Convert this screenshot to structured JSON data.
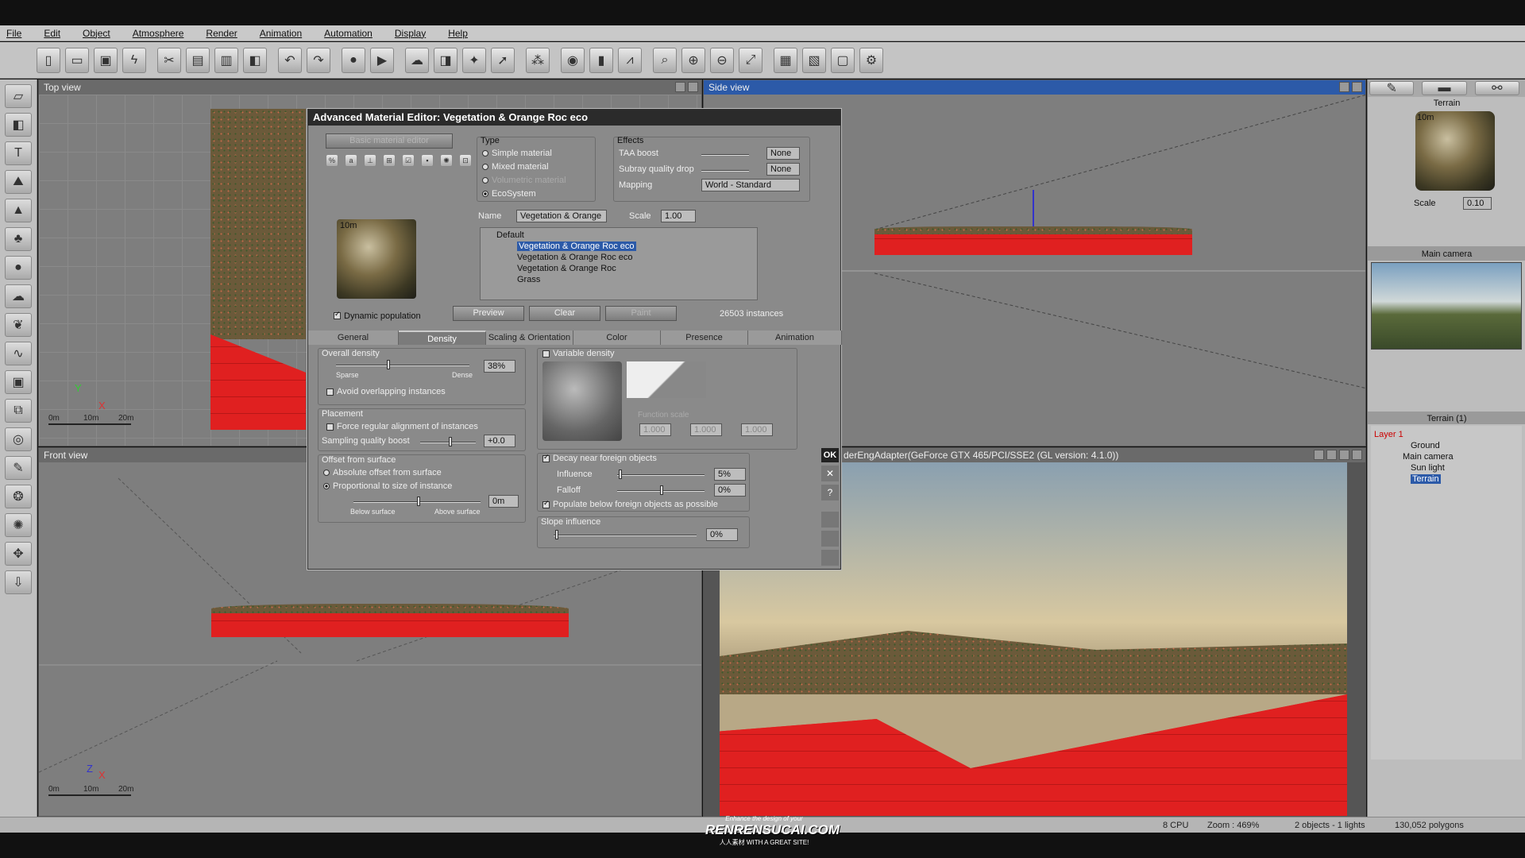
{
  "menu": [
    "File",
    "Edit",
    "Object",
    "Atmosphere",
    "Render",
    "Animation",
    "Automation",
    "Display",
    "Help"
  ],
  "toolbar_icons": [
    "new-icon",
    "open-icon",
    "save-icon",
    "bolt-icon",
    "cut-icon",
    "copy-icon",
    "paste-icon",
    "box-icon",
    "undo-icon",
    "redo-icon",
    "record-icon",
    "play-icon",
    "cloud-icon",
    "cube-icon",
    "wand-icon",
    "pointer-icon",
    "color-balls-icon",
    "sphere-icon",
    "bars-icon",
    "arrow-icon",
    "zoom-fit-icon",
    "zoom-in-icon",
    "zoom-out-icon",
    "pan-icon",
    "film-icon",
    "clapper-icon",
    "frame-icon",
    "render-icon"
  ],
  "viewports": {
    "top": {
      "title": "Top view",
      "scale": [
        "0m",
        "10m",
        "20m"
      ],
      "axis": [
        "Y",
        "X"
      ]
    },
    "front": {
      "title": "Front view",
      "scale": [
        "0m",
        "10m",
        "20m"
      ],
      "axis": [
        "Z",
        "X"
      ]
    },
    "side": {
      "title": "Side view"
    },
    "main": {
      "title": "derEngAdapter(GeForce GTX 465/PCI/SSE2 (GL version: 4.1.0))"
    }
  },
  "dialog": {
    "title": "Advanced Material Editor: Vegetation & Orange Roc eco",
    "basic_button": "Basic material editor",
    "preview_size": "10m",
    "dynamic_population": "Dynamic population",
    "type": {
      "label": "Type",
      "options": [
        "Simple material",
        "Mixed material",
        "Volumetric material",
        "EcoSystem"
      ],
      "selected": "EcoSystem"
    },
    "effects": {
      "label": "Effects",
      "taa_label": "TAA boost",
      "taa_value": "None",
      "subray_label": "Subray quality drop",
      "subray_value": "None",
      "mapping_label": "Mapping",
      "mapping_value": "World - Standard"
    },
    "name_label": "Name",
    "name_value": "Vegetation & Orange",
    "scale_label": "Scale",
    "scale_value": "1.00",
    "tree": [
      "Default",
      "Vegetation & Orange Roc eco",
      "Vegetation & Orange Roc eco",
      "Vegetation & Orange Roc",
      "Grass"
    ],
    "preview_btn": "Preview",
    "clear_btn": "Clear",
    "paint_btn": "Paint",
    "instances": "26503 instances",
    "tabs": [
      "General",
      "Density",
      "Scaling & Orientation",
      "Color",
      "Presence",
      "Animation"
    ],
    "active_tab": "Density",
    "overall_density": {
      "label": "Overall density",
      "sparse": "Sparse",
      "dense": "Dense",
      "value": "38%"
    },
    "avoid_overlap": "Avoid overlapping instances",
    "placement": {
      "label": "Placement",
      "force": "Force regular alignment of instances",
      "boost_label": "Sampling quality boost",
      "boost_value": "+0.0"
    },
    "offset": {
      "label": "Offset from surface",
      "absolute": "Absolute offset from surface",
      "proportional": "Proportional to size of instance",
      "below": "Below surface",
      "above": "Above surface",
      "value": "0m"
    },
    "variable_density": "Variable density",
    "function_scale": "Function scale",
    "fs_x": "1.000",
    "fs_y": "1.000",
    "fs_z": "1.000",
    "decay": "Decay near foreign objects",
    "influence_label": "Influence",
    "influence_value": "5%",
    "falloff_label": "Falloff",
    "falloff_value": "0%",
    "populate_below": "Populate below foreign objects as possible",
    "slope_label": "Slope influence",
    "slope_value": "0%",
    "ok": "OK",
    "close": "✕",
    "help": "?"
  },
  "right_panel": {
    "terrain_label": "Terrain",
    "preview_size": "10m",
    "scale_label": "Scale",
    "scale_value": "0.10",
    "camera_label": "Main camera",
    "list_label": "Terrain (1)",
    "layer": "Layer 1",
    "objects": [
      "Ground",
      "Main camera",
      "Sun light",
      "Terrain"
    ]
  },
  "status": {
    "cpu": "8 CPU",
    "zoom": "Zoom : 469%",
    "objects": "2 objects - 1 lights",
    "polygons": "130,052 polygons"
  },
  "watermark": {
    "line1": "Enhance the design of your",
    "brand": "RENRENSUCAI.COM",
    "tagline": "WITH A GREAT SITE!",
    "cn": "人人素材"
  }
}
